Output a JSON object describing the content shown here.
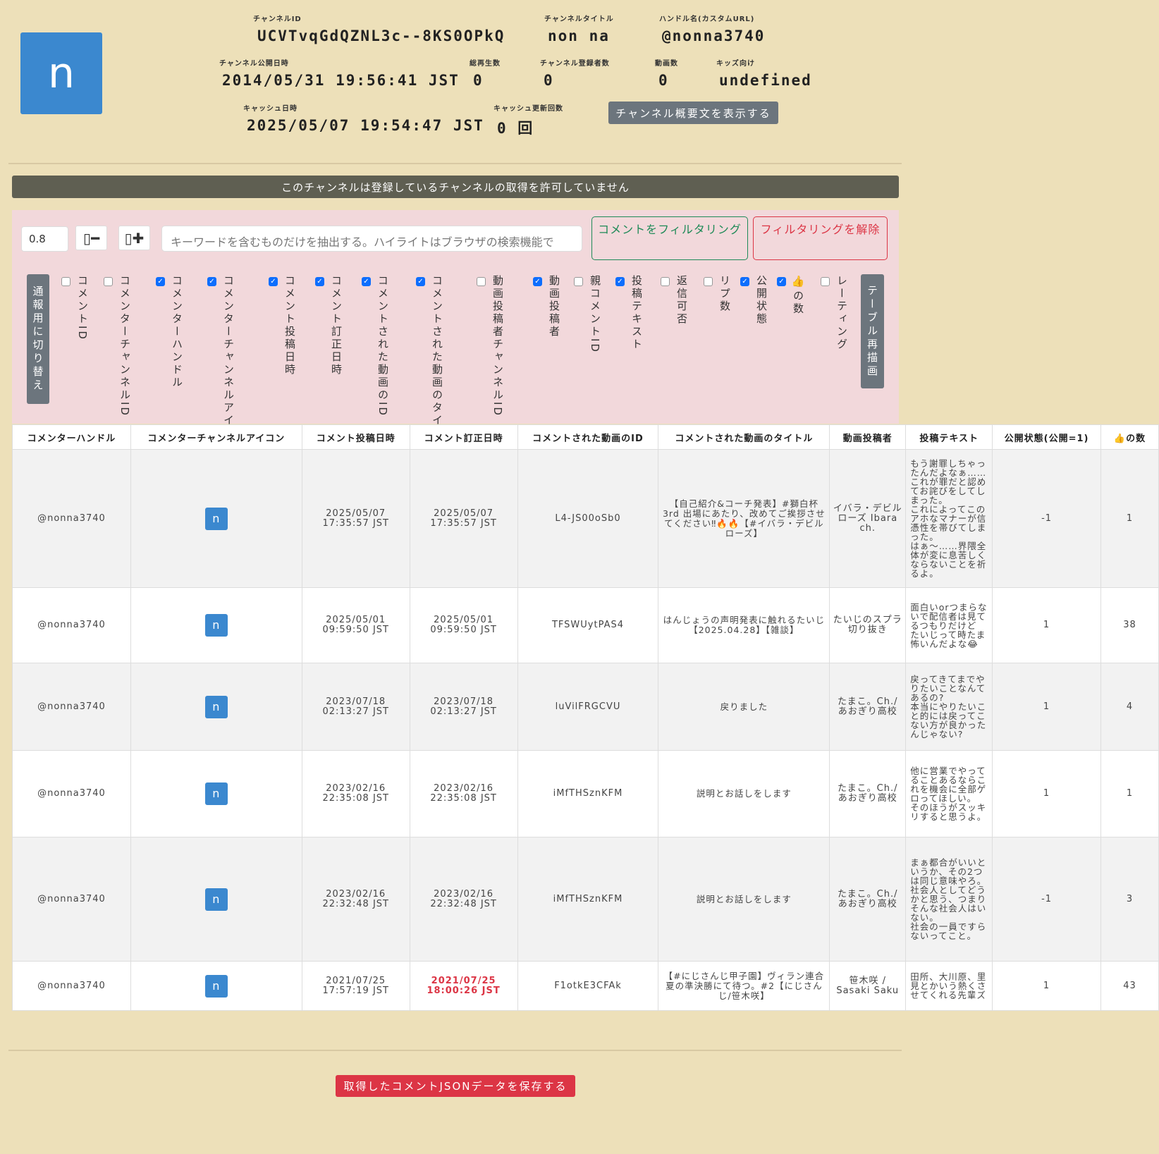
{
  "channel": {
    "avatar_letter": "n",
    "id_label": "チャンネルID",
    "id": "UCVTvqGdQZNL3c--8KS0OPkQ",
    "title_label": "チャンネルタイトル",
    "title": "non na",
    "handle_label": "ハンドル名(カスタムURL)",
    "handle": "@nonna3740",
    "published_label": "チャンネル公開日時",
    "published": "2014/05/31 19:56:41 JST",
    "views_label": "総再生数",
    "views": "0",
    "subs_label": "チャンネル登録者数",
    "subs": "0",
    "videos_label": "動画数",
    "videos": "0",
    "kids_label": "キッズ向け",
    "kids": "undefined",
    "cache_label": "キャッシュ日時",
    "cache": "2025/05/07 19:54:47 JST",
    "cache_count_label": "キャッシュ更新回数",
    "cache_count": "0 回",
    "desc_button": "チャンネル概要文を表示する"
  },
  "banner": "このチャンネルは登録しているチャンネルの取得を許可していません",
  "controls": {
    "scale_value": "0.8",
    "minus_glyph": "▯━",
    "plus_glyph": "▯✚",
    "keyword_placeholder": "キーワードを含むものだけを抽出する。ハイライトはブラウザの検索機能で",
    "filter_button": "コメントをフィルタリング",
    "unfilter_button": "フィルタリングを解除",
    "switch_button": "通報用に切り替え",
    "redraw_button": "テーブル再描画",
    "columns": [
      {
        "label": "コメントID",
        "checked": false
      },
      {
        "label": "コメンターチャンネルID",
        "checked": false
      },
      {
        "label": "コメンターハンドル",
        "checked": true
      },
      {
        "label": "コメンターチャンネルアイコン",
        "checked": true
      },
      {
        "label": "コメント投稿日時",
        "checked": true
      },
      {
        "label": "コメント訂正日時",
        "checked": true
      },
      {
        "label": "コメントされた動画のID",
        "checked": true
      },
      {
        "label": "コメントされた動画のタイトル",
        "checked": true
      },
      {
        "label": "動画投稿者チャンネルID",
        "checked": false
      },
      {
        "label": "動画投稿者",
        "checked": true
      },
      {
        "label": "親コメントID",
        "checked": false
      },
      {
        "label": "投稿テキスト",
        "checked": true
      },
      {
        "label": "返信可否",
        "checked": false
      },
      {
        "label": "リプ数",
        "checked": false
      },
      {
        "label": "公開状態",
        "checked": true
      },
      {
        "label": "👍の数",
        "checked": true
      },
      {
        "label": "レーティング",
        "checked": false
      }
    ]
  },
  "table": {
    "headers": [
      "コメンターハンドル",
      "コメンターチャンネルアイコン",
      "コメント投稿日時",
      "コメント訂正日時",
      "コメントされた動画のID",
      "コメントされた動画のタイトル",
      "動画投稿者",
      "投稿テキスト",
      "公開状態(公開=1)",
      "👍の数"
    ],
    "rows": [
      {
        "handle": "@nonna3740",
        "icon": "n",
        "posted": "2025/05/07\n17:35:57 JST",
        "edited": "2025/05/07\n17:35:57 JST",
        "edited_changed": false,
        "video_id": "L4-JS00oSb0",
        "video_title": "【自己紹介&コーチ発表】#獅白杯3rd 出場にあたり、改めてご挨拶させてください‼🔥🔥【#イバラ・デビルローズ】",
        "uploader": "イバラ・デビルローズ Ibara ch.",
        "text": "もう謝罪しちゃったんだよなぁ……これが罪だと認めてお詫びをしてしまった。\nこれによってこのアホなマナーが信憑性を帯びてしまった。\nはぁ〜……界隈全体が変に息苦しくならないことを祈るよ。",
        "public": "-1",
        "likes": "1",
        "height": 196
      },
      {
        "handle": "@nonna3740",
        "icon": "n",
        "posted": "2025/05/01\n09:59:50 JST",
        "edited": "2025/05/01\n09:59:50 JST",
        "edited_changed": false,
        "video_id": "TFSWUytPAS4",
        "video_title": "はんじょうの声明発表に触れるたいじ【2025.04.28】【雑談】",
        "uploader": "たいじのスプラ切り抜き",
        "text": "面白いorつまらないで配信者は見てるつもりだけど\nたいじって時たま怖いんだよな😂",
        "public": "1",
        "likes": "38",
        "height": 107
      },
      {
        "handle": "@nonna3740",
        "icon": "n",
        "posted": "2023/07/18\n02:13:27 JST",
        "edited": "2023/07/18\n02:13:27 JST",
        "edited_changed": false,
        "video_id": "luVilFRGCVU",
        "video_title": "戻りました",
        "uploader": "たまこ。Ch./あおぎり高校",
        "text": "戻ってきてまでやりたいことなんてあるの?\n本当にやりたいこと的には戻ってこない方が良かったんじゃない?",
        "public": "1",
        "likes": "4",
        "height": 124
      },
      {
        "handle": "@nonna3740",
        "icon": "n",
        "posted": "2023/02/16\n22:35:08 JST",
        "edited": "2023/02/16\n22:35:08 JST",
        "edited_changed": false,
        "video_id": "iMfTHSznKFM",
        "video_title": "説明とお話しをします",
        "uploader": "たまこ。Ch./あおぎり高校",
        "text": "他に営業でやってることあるならこれを機会に全部ゲロってほしい。\nそのほうがスッキリすると思うよ。",
        "public": "1",
        "likes": "1",
        "height": 123
      },
      {
        "handle": "@nonna3740",
        "icon": "n",
        "posted": "2023/02/16\n22:32:48 JST",
        "edited": "2023/02/16\n22:32:48 JST",
        "edited_changed": false,
        "video_id": "iMfTHSznKFM",
        "video_title": "説明とお話しをします",
        "uploader": "たまこ。Ch./あおぎり高校",
        "text": "まぁ都合がいいというか、その2つは同じ意味やろ。\n社会人としてどうかと思う、つまりそんな社会人はいない。\n社会の一員ですらないってこと。",
        "public": "-1",
        "likes": "3",
        "height": 176
      },
      {
        "handle": "@nonna3740",
        "icon": "n",
        "posted": "2021/07/25\n17:57:19 JST",
        "edited": "2021/07/25\n18:00:26 JST",
        "edited_changed": true,
        "video_id": "F1otkE3CFAk",
        "video_title": "【#にじさんじ甲子園】ヴィラン連合夏の準決勝にて待つ。#2【にじさんじ/笹木咲】",
        "uploader": "笹木咲 / Sasaki Saku",
        "text": "田所、大川原、里見とかいう熱くさせてくれる先輩ズ",
        "public": "1",
        "likes": "43",
        "height": 70
      }
    ]
  },
  "save_button": "取得したコメントJSONデータを保存する",
  "colors": {
    "background": "#ede0b9",
    "avatar": "#3b88cf",
    "filter_panel": "#f2d8db",
    "danger": "#dc3545",
    "success": "#1e8a57",
    "banner": "#5f5f52",
    "button": "#6c757d"
  }
}
